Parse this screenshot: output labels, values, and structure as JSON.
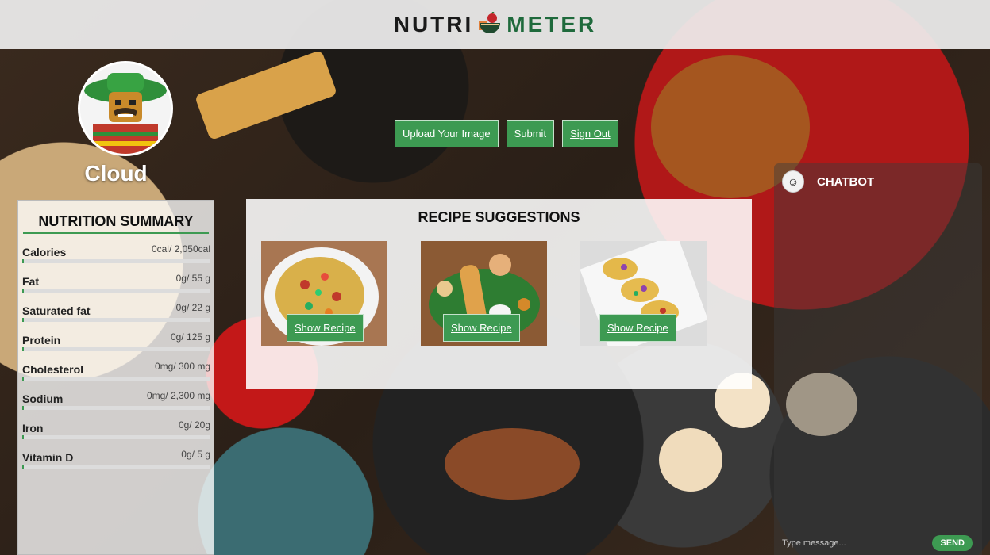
{
  "header": {
    "logo_left": "NUTRI",
    "logo_right": "METER"
  },
  "user": {
    "name": "Cloud"
  },
  "actions": {
    "upload_label": "Upload Your Image",
    "submit_label": "Submit",
    "signout_label": "Sign Out"
  },
  "nutrition": {
    "title": "NUTRITION SUMMARY",
    "items": [
      {
        "name": "Calories",
        "value": "0cal/ 2,050cal",
        "progress": 0
      },
      {
        "name": "Fat",
        "value": "0g/ 55 g",
        "progress": 0
      },
      {
        "name": "Saturated fat",
        "value": "0g/ 22 g",
        "progress": 0
      },
      {
        "name": "Protein",
        "value": "0g/ 125 g",
        "progress": 0
      },
      {
        "name": "Cholesterol",
        "value": "0mg/ 300 mg",
        "progress": 0
      },
      {
        "name": "Sodium",
        "value": "0mg/ 2,300 mg",
        "progress": 0
      },
      {
        "name": "Iron",
        "value": "0g/ 20g",
        "progress": 0
      },
      {
        "name": "Vitamin D",
        "value": "0g/ 5 g",
        "progress": 0
      }
    ]
  },
  "recipes": {
    "title": "RECIPE SUGGESTIONS",
    "items": [
      {
        "button": "Show Recipe"
      },
      {
        "button": "Show Recipe"
      },
      {
        "button": "Show Recipe"
      }
    ]
  },
  "chatbot": {
    "title": "CHATBOT",
    "input_placeholder": "Type message...",
    "send_label": "SEND"
  },
  "colors": {
    "accent": "#3d9a52",
    "logo_green": "#1f6a3c"
  }
}
